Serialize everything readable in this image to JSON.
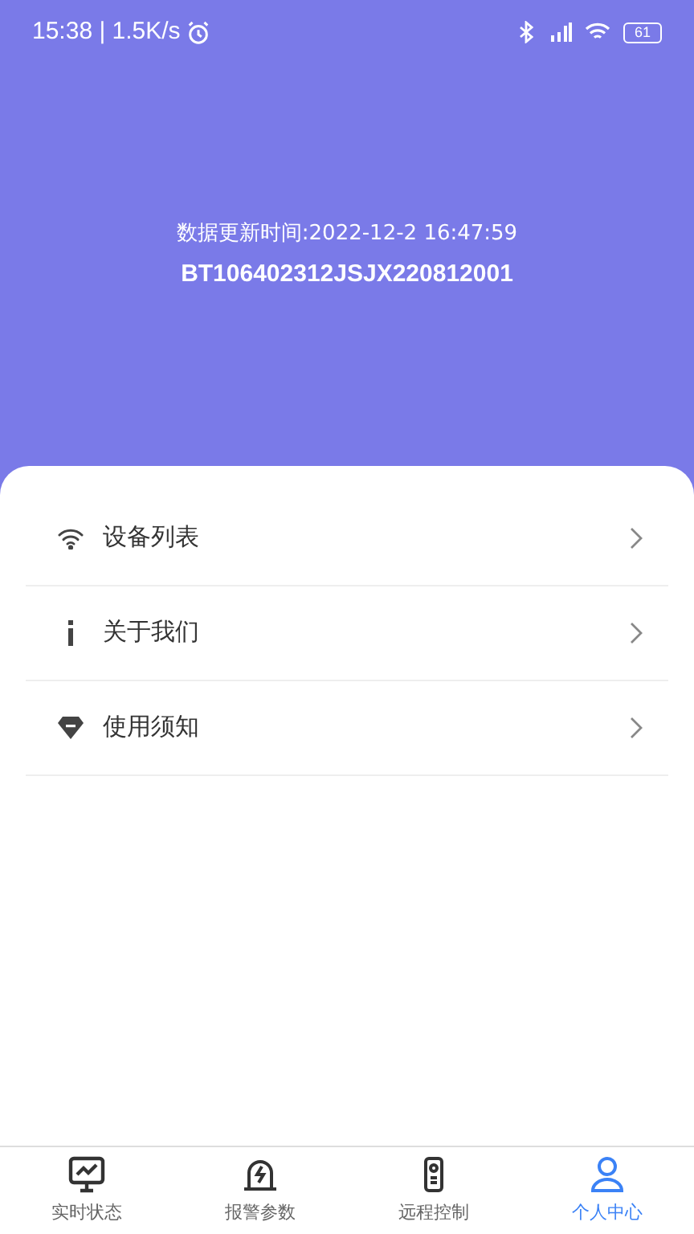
{
  "status_bar": {
    "time": "15:38 | 1.5K/s",
    "battery": "61"
  },
  "header": {
    "update_time": "数据更新时间:2022-12-2 16:47:59",
    "device_id": "BT106402312JSJX220812001"
  },
  "menu": [
    {
      "kind": "wifi",
      "label": "设备列表"
    },
    {
      "kind": "info",
      "label": "关于我们"
    },
    {
      "kind": "notice",
      "label": "使用须知"
    }
  ],
  "tabs": [
    {
      "kind": "monitor",
      "label": "实时状态",
      "selected": false
    },
    {
      "kind": "alarm",
      "label": "报警参数",
      "selected": false
    },
    {
      "kind": "control",
      "label": "远程控制",
      "selected": false
    },
    {
      "kind": "person",
      "label": "个人中心",
      "selected": true
    }
  ]
}
